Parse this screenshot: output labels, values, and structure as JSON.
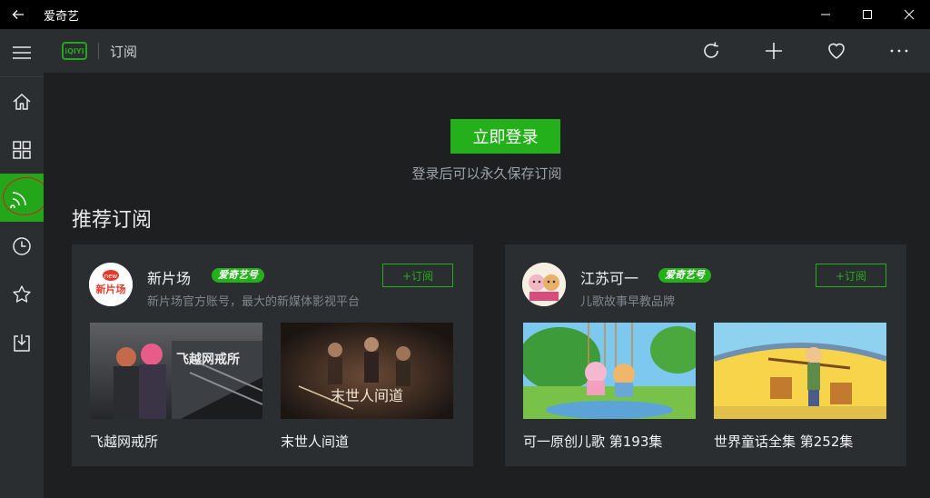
{
  "window": {
    "title": "爱奇艺"
  },
  "header": {
    "logo_text": "iQIYI",
    "section_title": "订阅"
  },
  "login": {
    "button_label": "立即登录",
    "hint": "登录后可以永久保存订阅"
  },
  "recommend": {
    "title": "推荐订阅",
    "channels": [
      {
        "name": "新片场",
        "badge": "爱奇艺号",
        "description": "新片场官方账号，最大的新媒体影视平台",
        "subscribe_label": "+订阅",
        "avatar_text": "新片场",
        "avatar_tag": "new",
        "videos": [
          {
            "title": "飞越网戒所",
            "overlay_text": "飞越网戒所"
          },
          {
            "title": "末世人间道",
            "overlay_text": "末世人间道"
          }
        ]
      },
      {
        "name": "江苏可一",
        "badge": "爱奇艺号",
        "description": "儿歌故事早教品牌",
        "subscribe_label": "+订阅",
        "videos": [
          {
            "title": "可一原创儿歌 第193集"
          },
          {
            "title": "世界童话全集 第252集"
          }
        ]
      }
    ]
  },
  "colors": {
    "accent": "#24b01a",
    "sidebar": "#2b2e31",
    "background": "#1d1f20",
    "annotation": "#d21f1f"
  }
}
